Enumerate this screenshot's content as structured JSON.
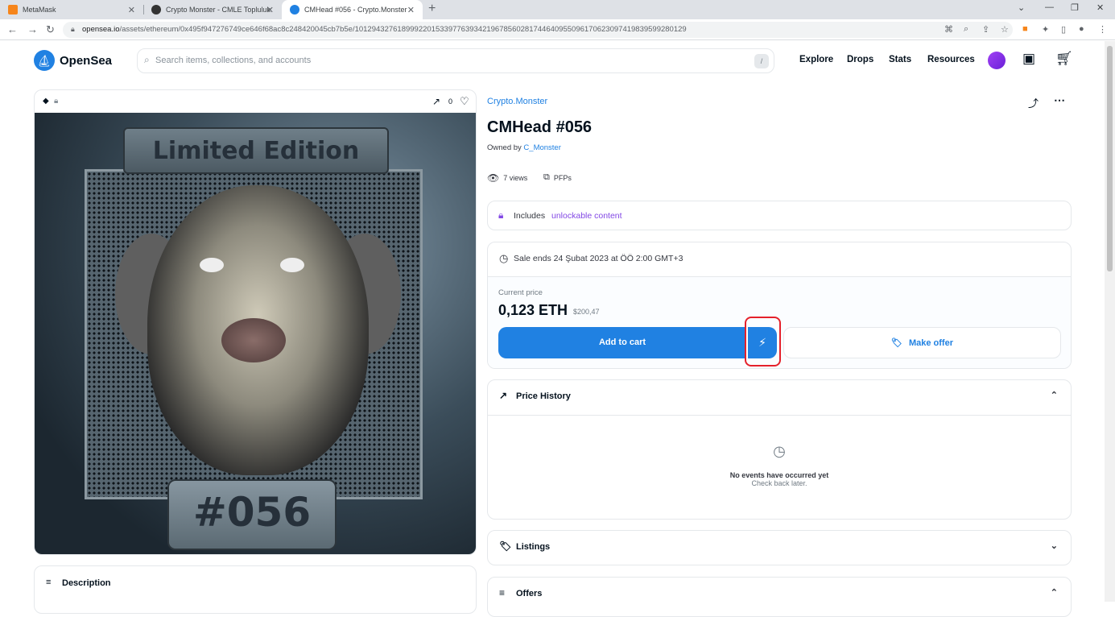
{
  "browser": {
    "tabs": [
      {
        "title": "MetaMask"
      },
      {
        "title": "Crypto Monster - CMLE Topluluk"
      },
      {
        "title": "CMHead #056 - Crypto.Monster"
      }
    ],
    "url_host": "opensea.io",
    "url_path": "/assets/ethereum/0x495f947276749ce646f68ac8c248420045cb7b5e/10129432761899922015339776393421967856028174464095509617062309741983959928012​9"
  },
  "header": {
    "brand": "OpenSea",
    "search_placeholder": "Search items, collections, and accounts",
    "search_shortcut": "/",
    "nav": [
      "Explore",
      "Drops",
      "Stats",
      "Resources"
    ]
  },
  "media": {
    "favorites_count": "0",
    "plate_top": "Limited Edition",
    "plate_bottom": "#056"
  },
  "description": {
    "title": "Description"
  },
  "item": {
    "collection": "Crypto.Monster",
    "name": "CMHead #056",
    "owned_prefix": "Owned by",
    "owner": "C_Monster",
    "views": "7 views",
    "category": "PFPs",
    "unlock_prefix": "Includes",
    "unlock_link": "unlockable content"
  },
  "sale": {
    "ends": "Sale ends 24 Şubat 2023 at ÖÖ 2:00 GMT+3",
    "price_label": "Current price",
    "price": "0,123 ETH",
    "price_usd": "$200,47",
    "add_to_cart": "Add to cart",
    "make_offer": "Make offer"
  },
  "price_history": {
    "title": "Price History",
    "empty_title": "No events have occurred yet",
    "empty_sub": "Check back later."
  },
  "listings": {
    "title": "Listings"
  },
  "offers": {
    "title": "Offers"
  },
  "colors": {
    "accent": "#2081e2",
    "highlight": "#e5212b"
  }
}
